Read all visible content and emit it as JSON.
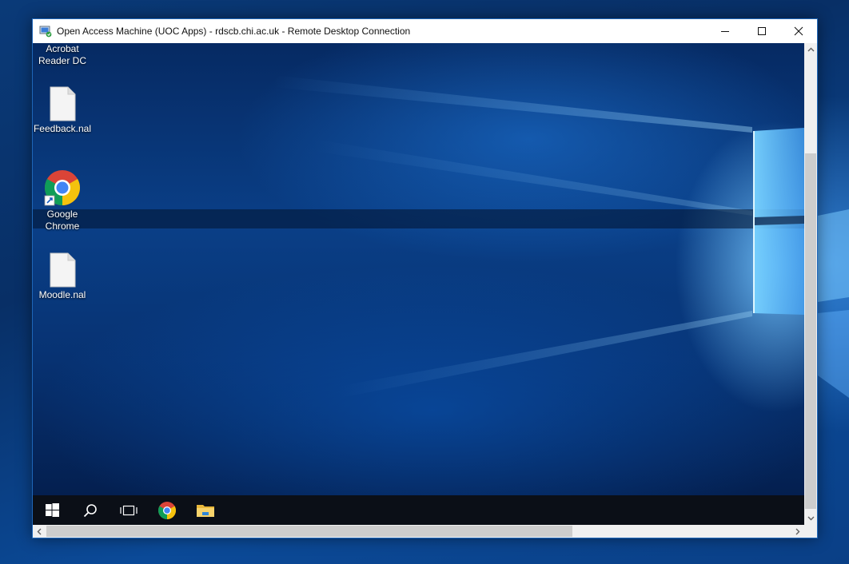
{
  "window": {
    "title": "Open Access Machine (UOC Apps) - rdscb.chi.ac.uk - Remote Desktop Connection",
    "controls": {
      "minimize_icon": "minimize-icon",
      "maximize_icon": "maximize-icon",
      "close_icon": "close-icon"
    }
  },
  "desktop": {
    "icons": [
      {
        "label_line1": "Acrobat",
        "label_line2": "Reader DC",
        "icon": "acrobat-icon"
      },
      {
        "label_line1": "Feedback.nal",
        "label_line2": "",
        "icon": "file-icon"
      },
      {
        "label_line1": "Google",
        "label_line2": "Chrome",
        "icon": "chrome-icon"
      },
      {
        "label_line1": "Moodle.nal",
        "label_line2": "",
        "icon": "file-icon"
      }
    ]
  },
  "taskbar": {
    "items": [
      "start-icon",
      "search-icon",
      "task-view-icon",
      "chrome-icon",
      "file-explorer-icon"
    ]
  },
  "colors": {
    "taskbar_bg": "#0b0f17",
    "window_border": "#1e66b8",
    "scrollbar_thumb": "#cdcdcd"
  }
}
